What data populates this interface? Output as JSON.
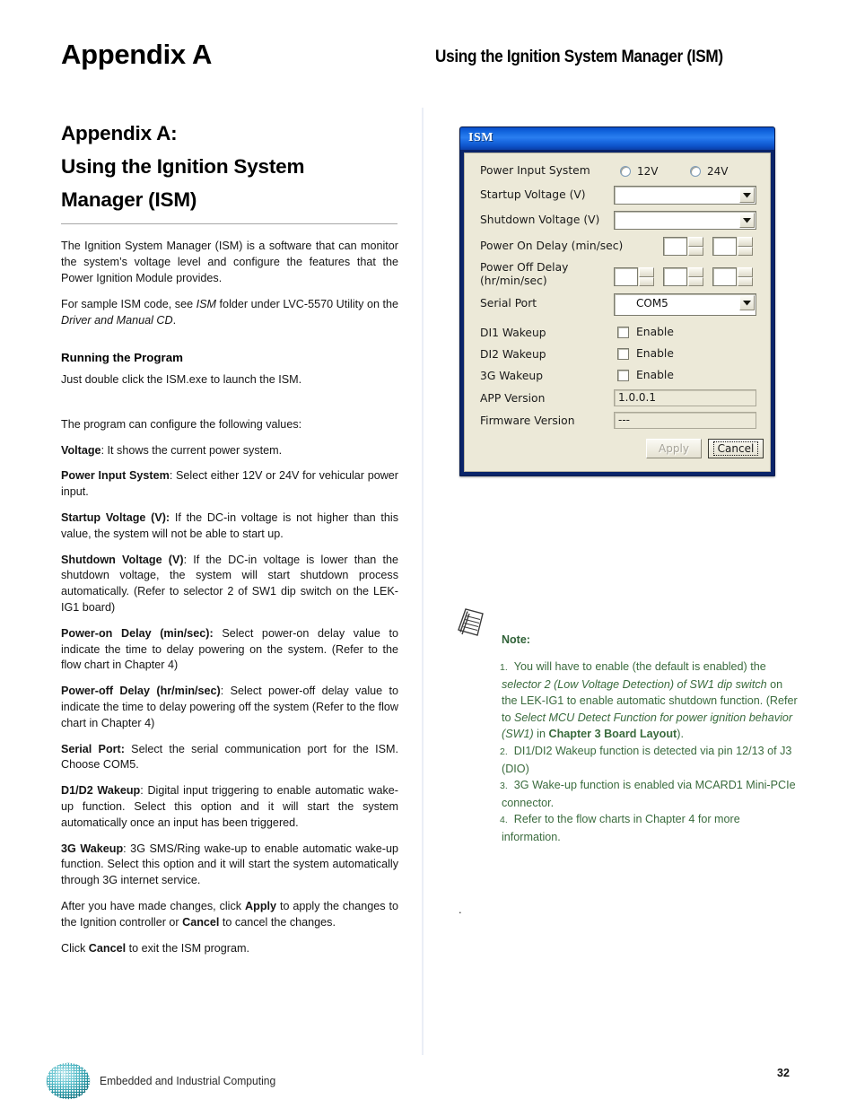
{
  "header": {
    "appendix_title": "Appendix A",
    "running_header": "Using the Ignition System Manager (ISM)"
  },
  "left_column": {
    "section_heading_line1": "Appendix A:",
    "section_heading_line2": "Using the Ignition System",
    "section_heading_line3": "Manager (ISM)",
    "intro_p1": "The Ignition System Manager (ISM) is a software that can monitor the system’s voltage level and configure the features that the Power Ignition Module provides.",
    "intro_p2_a": "For sample ISM code, see ",
    "intro_p2_em1": "ISM",
    "intro_p2_b": " folder under LVC-5570 Utility on the ",
    "intro_p2_em2": "Driver and Manual CD",
    "intro_p2_c": ".",
    "running_heading": "Running the Program",
    "running_text": "Just double click the ISM.exe to launch the ISM.",
    "configure_intro": "The program can configure the following values:",
    "items": [
      {
        "term": "Voltage",
        "text": ": It shows the current power system."
      },
      {
        "term": "Power Input System",
        "text": ": Select either 12V or 24V for vehicular power input."
      },
      {
        "term": "Startup Voltage (V):",
        "text": "  If the DC-in voltage is not higher than this value, the system will not be able to start up."
      },
      {
        "term": "Shutdown Voltage (V)",
        "text": ": If the DC-in voltage is lower than the shutdown voltage, the system will start shutdown process automatically. (Refer to selector 2 of SW1 dip switch on the LEK-IG1 board)"
      },
      {
        "term": "Power-on Delay (min/sec):",
        "text": " Select power-on delay value to indicate the time to delay powering on the system. (Refer to the flow chart in Chapter 4)"
      },
      {
        "term": "Power-off Delay (hr/min/sec)",
        "text": ": Select power-off delay value to indicate the time to delay powering off the system (Refer to the flow chart in Chapter 4)"
      },
      {
        "term": "Serial Port:",
        "text": " Select the serial communication port for the ISM. Choose COM5."
      },
      {
        "term": "D1/D2 Wakeup",
        "text": ": Digital input triggering to enable automatic wake-up function. Select this option and it will start the system automatically once an input has been triggered."
      },
      {
        "term": "3G Wakeup",
        "text": ": 3G SMS/Ring wake-up to enable automatic wake-up function. Select this option and it will start the system automatically through 3G internet service."
      }
    ],
    "apply_p_a": "After you have made changes, click ",
    "apply_p_b1": "Apply",
    "apply_p_c": " to apply the changes to the Ignition controller or ",
    "apply_p_b2": "Cancel",
    "apply_p_d": " to cancel the changes.",
    "exit_p_a": "Click ",
    "exit_p_b": "Cancel",
    "exit_p_c": " to exit the ISM program."
  },
  "ism_dialog": {
    "title": "ISM",
    "rows": {
      "power_input_system": {
        "label": "Power Input System",
        "options": [
          "12V",
          "24V"
        ],
        "selected": ""
      },
      "startup_voltage": {
        "label": "Startup Voltage (V)",
        "value": ""
      },
      "shutdown_voltage": {
        "label": "Shutdown Voltage (V)",
        "value": ""
      },
      "power_on_delay": {
        "label": "Power On Delay (min/sec)",
        "min_value": "",
        "sec_value": ""
      },
      "power_off_delay": {
        "label_line1": "Power Off Delay",
        "label_line2": "(hr/min/sec)",
        "hr_value": "",
        "min_value": "",
        "sec_value": ""
      },
      "serial_port": {
        "label": "Serial Port",
        "value": "COM5"
      },
      "di1_wakeup": {
        "label": "DI1 Wakeup",
        "checkbox_label": "Enable",
        "checked": false
      },
      "di2_wakeup": {
        "label": "DI2 Wakeup",
        "checkbox_label": "Enable",
        "checked": false
      },
      "g3_wakeup": {
        "label": "3G Wakeup",
        "checkbox_label": "Enable",
        "checked": false
      },
      "app_version": {
        "label": "APP Version",
        "value": "1.0.0.1"
      },
      "firmware_version": {
        "label": "Firmware Version",
        "value": "---"
      }
    },
    "buttons": {
      "apply": "Apply",
      "cancel": "Cancel"
    }
  },
  "note": {
    "heading": "Note:",
    "items": [
      {
        "num": "1.",
        "a": "You will have to enable (the default is enabled) the ",
        "em1": "selector 2 (Low Voltage Detection) of SW1 dip switch",
        "b": " on the LEK-IG1 to enable automatic shutdown function. (Refer to ",
        "em2": "Select MCU Detect Function for power ignition behavior (SW1)",
        "c": " in ",
        "bold": "Chapter 3 Board Layout",
        "d": ")."
      },
      {
        "num": "2.",
        "a": "DI1/DI2 Wakeup function is detected via pin 12/13 of J3 (DIO)"
      },
      {
        "num": "3.",
        "a": "3G Wake-up function is enabled via MCARD1 Mini-PCIe connector."
      },
      {
        "num": "4.",
        "a": "Refer to the flow charts in Chapter 4 for more information."
      }
    ],
    "stray_mark": "."
  },
  "footer": {
    "tagline": "Embedded and Industrial Computing",
    "page_number": "32"
  },
  "colors": {
    "note_green": "#3a6b3d",
    "note_heading_green": "#2f6137",
    "dialog_face": "#ece9d8",
    "title_blue": "#1468e0",
    "logo_teal": "#2aa8b5"
  }
}
